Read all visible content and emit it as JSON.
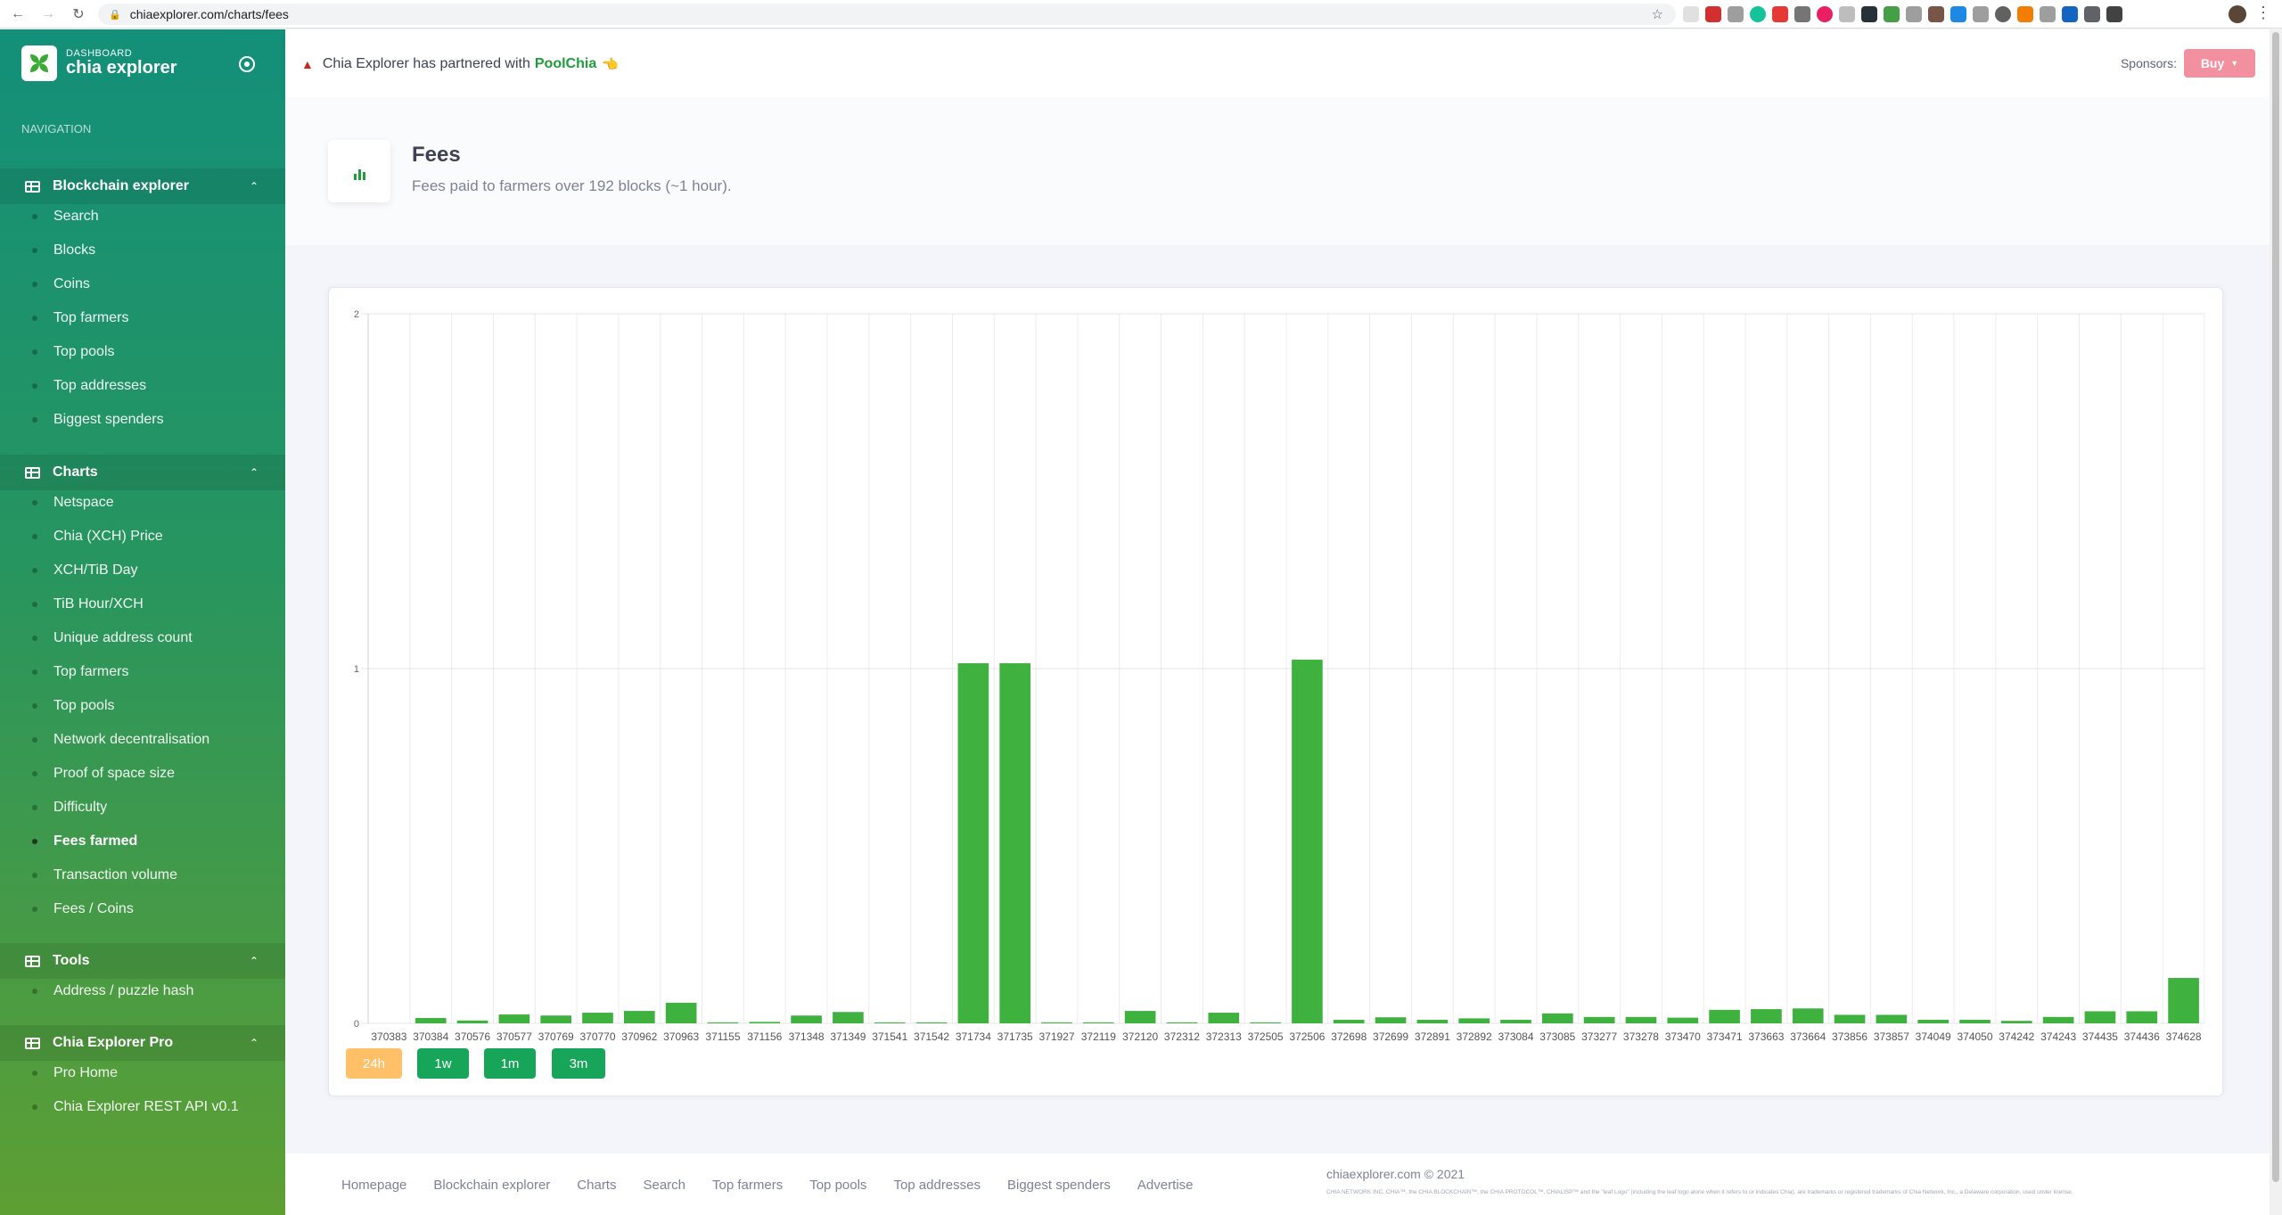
{
  "browser": {
    "url": "chiaexplorer.com/charts/fees"
  },
  "brand": {
    "small": "DASHBOARD",
    "name": "chia explorer"
  },
  "sidebar": {
    "heading": "NAVIGATION",
    "sections": [
      {
        "label": "Blockchain explorer",
        "items": [
          "Search",
          "Blocks",
          "Coins",
          "Top farmers",
          "Top pools",
          "Top addresses",
          "Biggest spenders"
        ]
      },
      {
        "label": "Charts",
        "items": [
          "Netspace",
          "Chia (XCH) Price",
          "XCH/TiB Day",
          "TiB Hour/XCH",
          "Unique address count",
          "Top farmers",
          "Top pools",
          "Network decentralisation",
          "Proof of space size",
          "Difficulty",
          "Fees farmed",
          "Transaction volume",
          "Fees / Coins"
        ]
      },
      {
        "label": "Tools",
        "items": [
          "Address / puzzle hash"
        ]
      },
      {
        "label": "Chia Explorer Pro",
        "items": [
          "Pro Home",
          "Chia Explorer REST API v0.1"
        ]
      }
    ],
    "active_item": "Fees farmed"
  },
  "header": {
    "announcement_prefix": "Chia Explorer has partnered with",
    "partner": "PoolChia",
    "sponsors_label": "Sponsors:",
    "buy_label": "Buy"
  },
  "page": {
    "title": "Fees",
    "subtitle": "Fees paid to farmers over 192 blocks (~1 hour)."
  },
  "range_buttons": [
    "24h",
    "1w",
    "1m",
    "3m"
  ],
  "active_range": "24h",
  "colors": {
    "accent": "#1e9d3a",
    "bar": "#3fb13f",
    "buy": "#f3909f",
    "range_active": "#ffc067",
    "range_normal": "#17a559"
  },
  "chart_data": {
    "type": "bar",
    "title": "",
    "xlabel": "",
    "ylabel": "",
    "ylim": [
      0,
      2
    ],
    "yticks": [
      0,
      1,
      2
    ],
    "grid": true,
    "categories": [
      "370383",
      "370384",
      "370576",
      "370577",
      "370769",
      "370770",
      "370962",
      "370963",
      "371155",
      "371156",
      "371348",
      "371349",
      "371541",
      "371542",
      "371734",
      "371735",
      "371927",
      "372119",
      "372120",
      "372312",
      "372313",
      "372505",
      "372506",
      "372698",
      "372699",
      "372891",
      "372892",
      "373084",
      "373085",
      "373277",
      "373278",
      "373470",
      "373471",
      "373663",
      "373664",
      "373856",
      "373857",
      "374049",
      "374050",
      "374242",
      "374243",
      "374435",
      "374436",
      "374628"
    ],
    "values": [
      0,
      0.015,
      0.008,
      0.025,
      0.022,
      0.03,
      0.035,
      0.058,
      0.002,
      0.004,
      0.022,
      0.032,
      0.001,
      0.002,
      1.015,
      1.015,
      0.002,
      0.001,
      0.035,
      0.002,
      0.03,
      0.001,
      1.025,
      0.01,
      0.017,
      0.01,
      0.014,
      0.01,
      0.028,
      0.018,
      0.018,
      0.016,
      0.038,
      0.04,
      0.042,
      0.024,
      0.024,
      0.01,
      0.01,
      0.007,
      0.018,
      0.034,
      0.034,
      0.128
    ]
  },
  "footer": {
    "links": [
      "Homepage",
      "Blockchain explorer",
      "Charts",
      "Search",
      "Top farmers",
      "Top pools",
      "Top addresses",
      "Biggest spenders",
      "Advertise"
    ],
    "copyright": "chiaexplorer.com © 2021",
    "legal": "CHIA NETWORK INC, CHIA™, the CHIA BLOCKCHAIN™, the CHIA PROTOCOL™, CHIALISP™ and the \"leaf Logo\" (including the leaf logo alone when it refers to or indicates Chia), are trademarks or registered trademarks of Chia Network, Inc., a Delaware corporation, used under license."
  }
}
